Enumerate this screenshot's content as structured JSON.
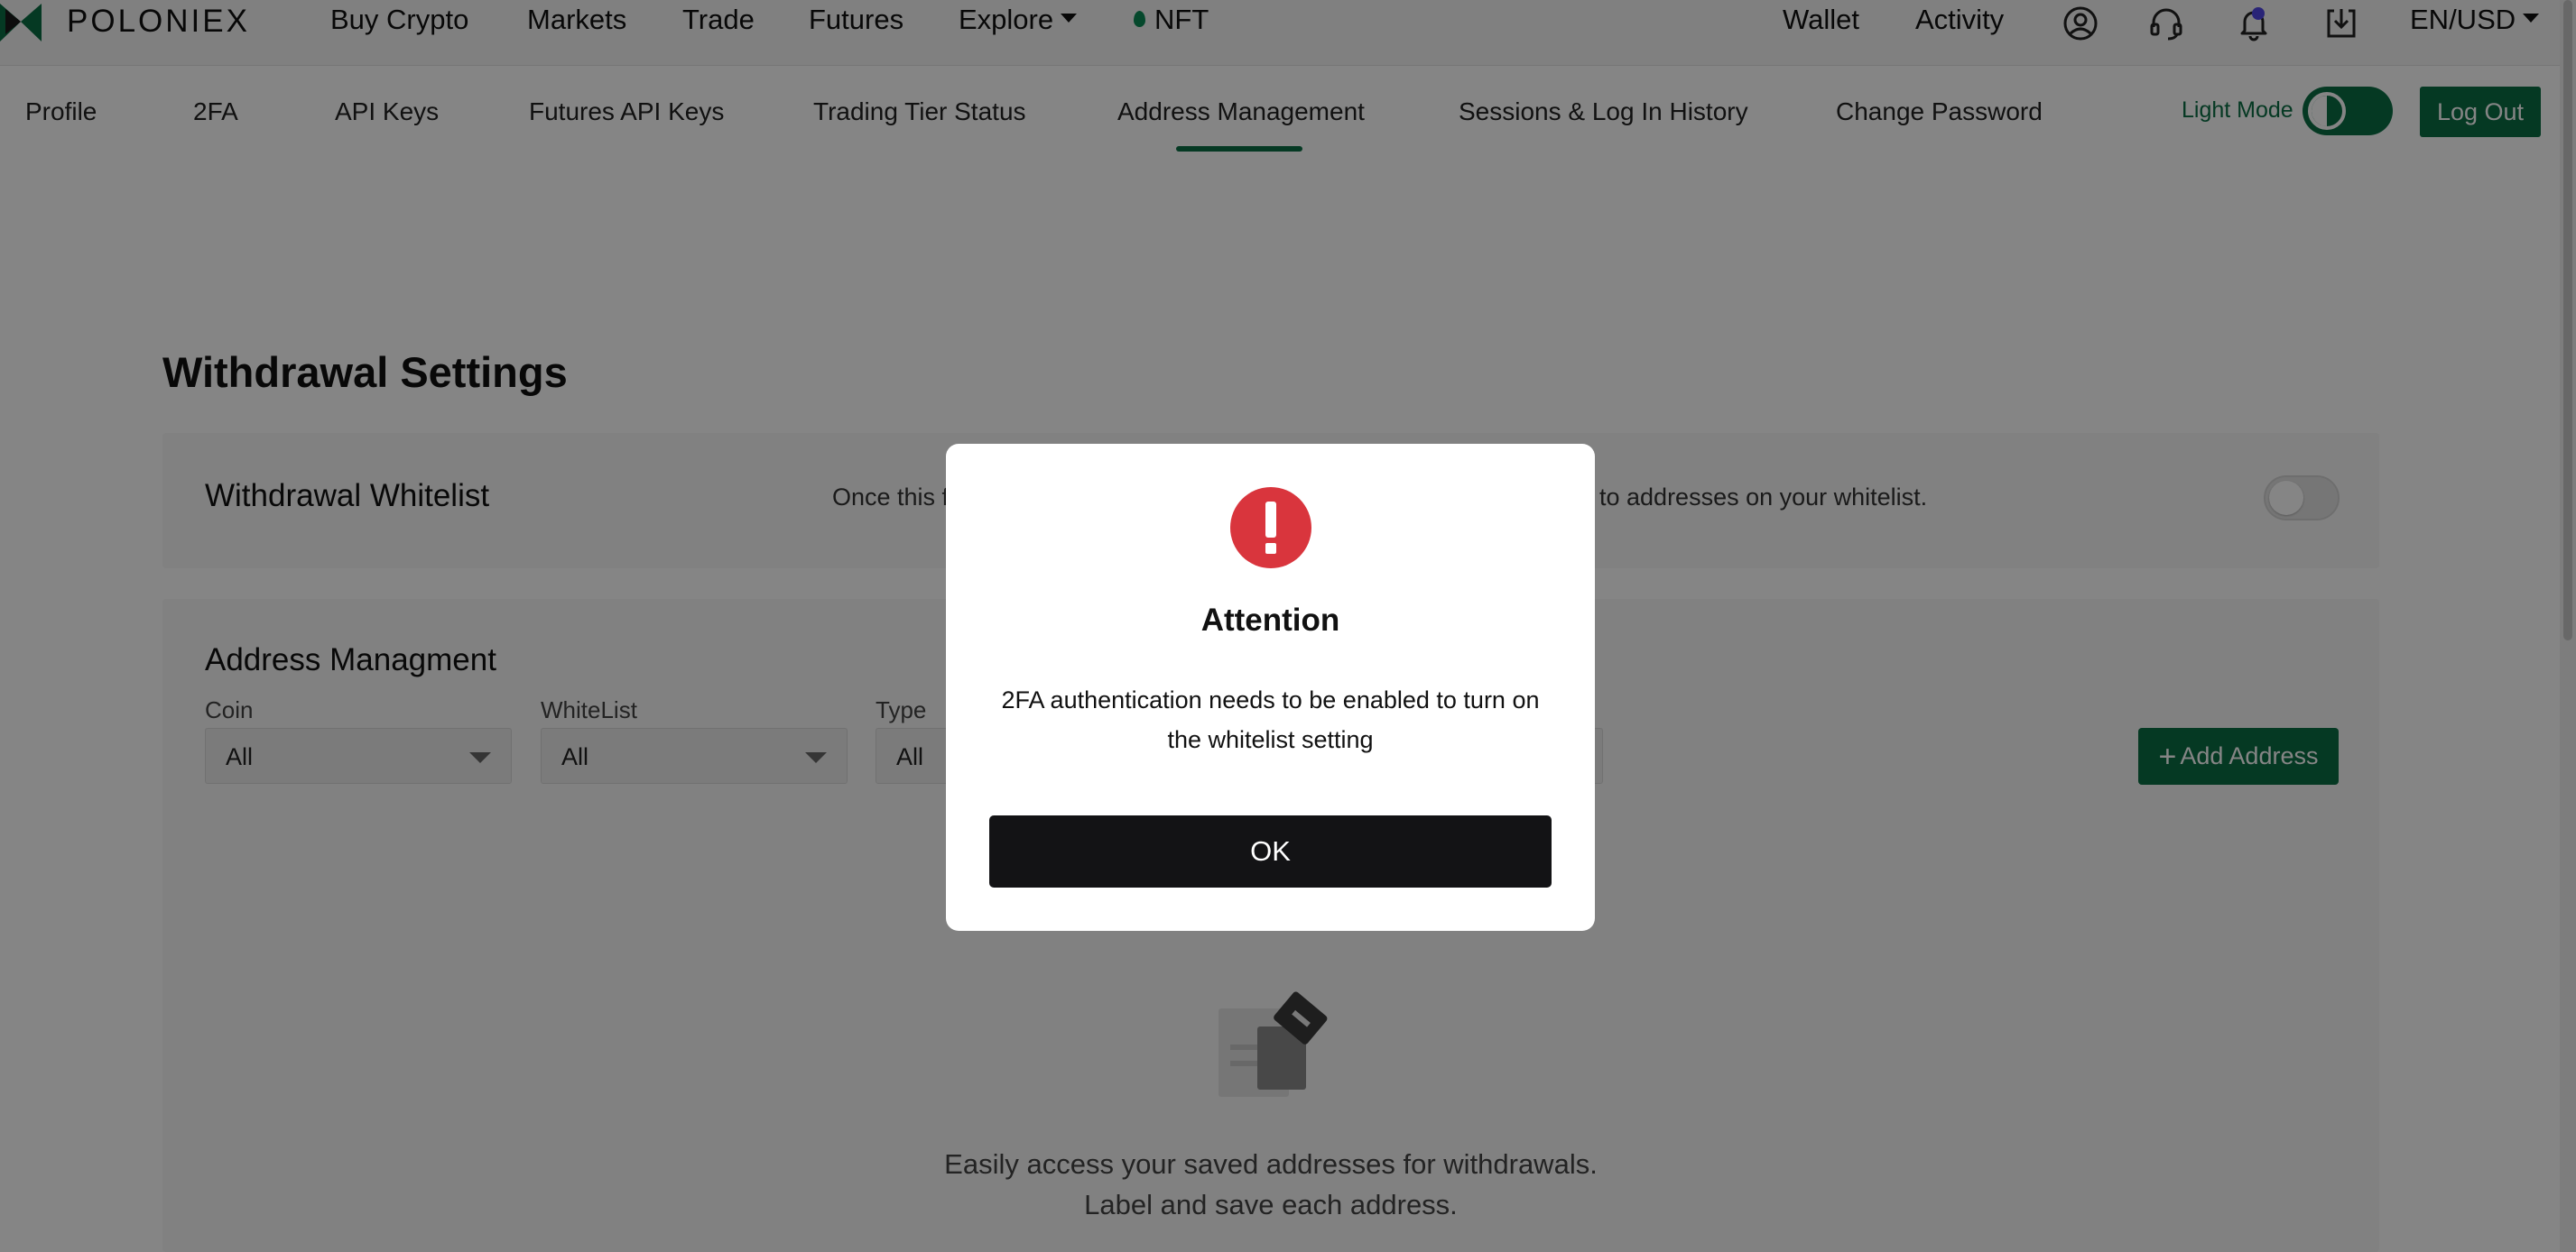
{
  "brand": {
    "name": "POLONIEX",
    "accent": "#0a6e44"
  },
  "topnav": {
    "links": [
      "Buy Crypto",
      "Markets",
      "Trade",
      "Futures",
      "Explore",
      "NFT"
    ],
    "right_links": [
      "Wallet",
      "Activity"
    ],
    "icons": [
      "user-circle-icon",
      "headset-icon",
      "bell-icon",
      "download-icon"
    ],
    "locale": "EN/USD"
  },
  "subnav": {
    "tabs": [
      "Profile",
      "2FA",
      "API Keys",
      "Futures API Keys",
      "Trading Tier Status",
      "Address Management",
      "Sessions & Log In History",
      "Change Password"
    ],
    "active_tab": "Address Management",
    "theme_label": "Light Mode",
    "logout_label": "Log Out"
  },
  "main": {
    "title": "Withdrawal Settings",
    "whitelist": {
      "title": "Withdrawal Whitelist",
      "description_start": "Once this fu",
      "description_end": "to addresses on your whitelist.",
      "enabled": false
    },
    "address_management": {
      "title": "Address Managment",
      "filters": [
        {
          "label": "Coin",
          "value": "All"
        },
        {
          "label": "WhiteList",
          "value": "All"
        },
        {
          "label": "Type",
          "value": "All"
        }
      ],
      "add_button_label": "Add Address",
      "empty_line1": "Easily access your saved addresses for withdrawals.",
      "empty_line2": "Label and save each address."
    }
  },
  "modal": {
    "icon": "exclamation-icon",
    "icon_color": "#d9353d",
    "title": "Attention",
    "message": "2FA authentication needs to be enabled to turn on the whitelist setting",
    "ok_label": "OK"
  }
}
